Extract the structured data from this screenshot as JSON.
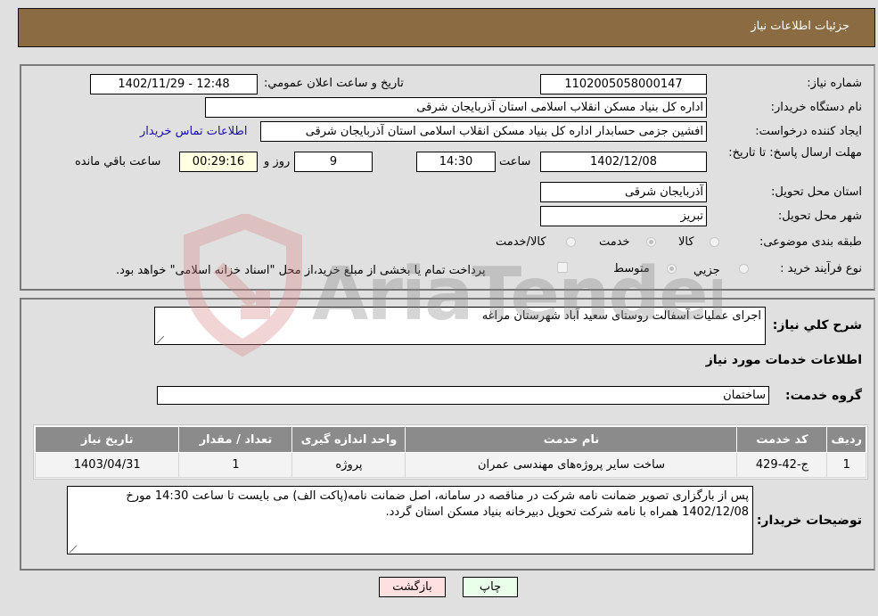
{
  "header": {
    "title": "جزئیات اطلاعات نیاز"
  },
  "info": {
    "need_number_label": "شماره نیاز:",
    "need_number": "1102005058000147",
    "announce_label": "تاریخ و ساعت اعلان عمومي:",
    "announce_value": "1402/11/29 - 12:48",
    "buyer_org_label": "نام دستگاه خریدار:",
    "buyer_org": "اداره کل بنیاد مسکن انقلاب اسلامی استان آذربایجان شرقی",
    "creator_label": "ایجاد کننده درخواست:",
    "creator": "افشین جزمی حسابدار اداره کل بنیاد مسکن انقلاب اسلامی استان آذربایجان شرقی",
    "contact_link": "اطلاعات تماس خریدار",
    "deadline_label": "مهلت ارسال پاسخ: تا تاریخ:",
    "deadline_date": "1402/12/08",
    "time_label": "ساعت",
    "deadline_time": "14:30",
    "days_value": "9",
    "days_label": "روز و",
    "remaining_time": "00:29:16",
    "remaining_label": "ساعت باقي مانده",
    "province_label": "استان محل تحویل:",
    "province": "آذربایجان شرقی",
    "city_label": "شهر محل تحویل:",
    "city": "تبریز",
    "category_label": "طبقه بندی موضوعی:",
    "category_options": [
      {
        "label": "کالا",
        "checked": false
      },
      {
        "label": "خدمت",
        "checked": true
      },
      {
        "label": "کالا/خدمت",
        "checked": false
      }
    ],
    "process_label": "نوع فرآیند خرید :",
    "process_options": [
      {
        "label": "جزيي",
        "checked": false
      },
      {
        "label": "متوسط",
        "checked": true
      }
    ],
    "treasury_note": "پرداخت تمام یا بخشی از مبلغ خرید،از محل \"اسناد خزانه اسلامی\" خواهد بود."
  },
  "details": {
    "summary_label": "شرح کلي نياز:",
    "summary": "اجرای عملیات آسفالت روستای سعید آباد شهرستان مراغه",
    "services_heading": "اطلاعات خدمات مورد نیاز",
    "service_group_label": "گروه خدمت:",
    "service_group": "ساختمان",
    "table": {
      "headers": [
        "ردیف",
        "کد خدمت",
        "نام خدمت",
        "واحد اندازه گیری",
        "تعداد / مقدار",
        "تاریخ نیاز"
      ],
      "rows": [
        [
          "1",
          "ج-42-429",
          "ساخت سایر پروژه‌های مهندسی عمران",
          "پروژه",
          "1",
          "1403/04/31"
        ]
      ]
    },
    "buyer_notes_label": "توضیحات خریدار:",
    "buyer_notes": "پس از بارگزاری تصویر ضمانت نامه شرکت در مناقصه در سامانه، اصل ضمانت نامه(پاکت الف) می بایست تا ساعت 14:30 مورخ  1402/12/08 همراه با نامه شرکت تحویل دبیرخانه بنیاد مسکن استان گردد."
  },
  "buttons": {
    "print": "چاپ",
    "back": "بازگشت"
  },
  "watermark": {
    "text": "AriaTender.neT"
  }
}
